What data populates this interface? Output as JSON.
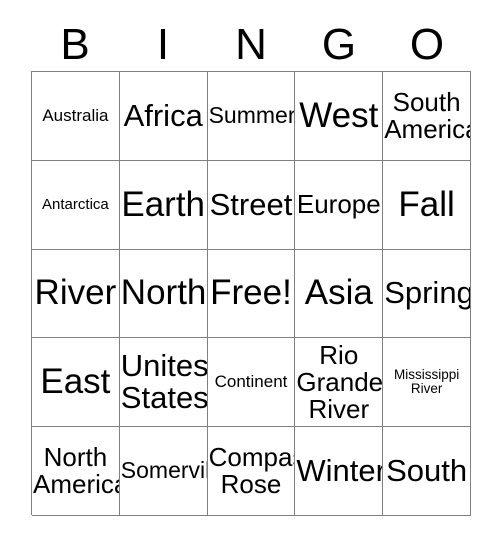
{
  "card": {
    "type": "bingo-card",
    "columns": 5,
    "rows": 5,
    "border_color": "#808080",
    "cell_background": "#ffffff",
    "text_color": "#000000"
  },
  "header": {
    "letters": [
      "B",
      "I",
      "N",
      "G",
      "O"
    ]
  },
  "grid": {
    "rows": [
      [
        {
          "text": "Australia",
          "size": "xs"
        },
        {
          "text": "Africa",
          "size": "lg"
        },
        {
          "text": "Summer",
          "size": "sm"
        },
        {
          "text": "West",
          "size": "xl"
        },
        {
          "text": "South\nAmerica",
          "size": "md"
        }
      ],
      [
        {
          "text": "Antarctica",
          "size": "xxs"
        },
        {
          "text": "Earth",
          "size": "xl"
        },
        {
          "text": "Street",
          "size": "lg"
        },
        {
          "text": "Europe",
          "size": "md"
        },
        {
          "text": "Fall",
          "size": "xl"
        }
      ],
      [
        {
          "text": "River",
          "size": "xl"
        },
        {
          "text": "North",
          "size": "xl"
        },
        {
          "text": "Free!",
          "size": "xl"
        },
        {
          "text": "Asia",
          "size": "xl"
        },
        {
          "text": "Spring",
          "size": "lg"
        }
      ],
      [
        {
          "text": "East",
          "size": "xl"
        },
        {
          "text": "Unites\nStates",
          "size": "lg"
        },
        {
          "text": "Continent",
          "size": "xs"
        },
        {
          "text": "Rio\nGrande\nRiver",
          "size": "md"
        },
        {
          "text": "Mississippi\nRiver",
          "size": "tiny"
        }
      ],
      [
        {
          "text": "North\nAmerica",
          "size": "md"
        },
        {
          "text": "Somerville",
          "size": "sm"
        },
        {
          "text": "Compass\nRose",
          "size": "md"
        },
        {
          "text": "Winter",
          "size": "lg"
        },
        {
          "text": "South",
          "size": "lg"
        }
      ]
    ]
  }
}
